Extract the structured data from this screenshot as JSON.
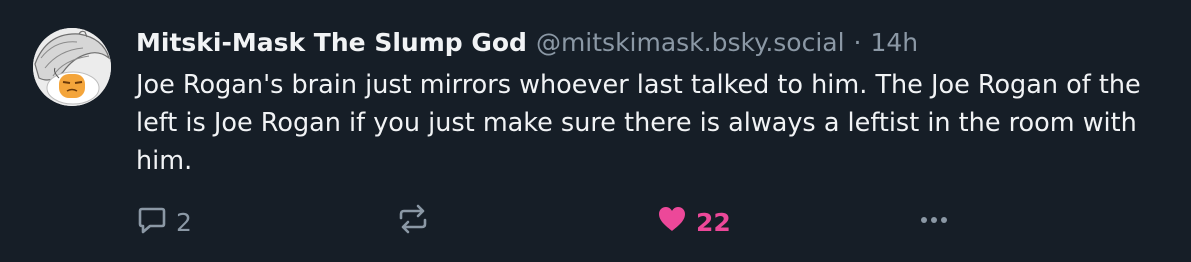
{
  "post": {
    "author": {
      "display_name": "Mitski-Mask The Slump God",
      "handle": "@mitskimask.bsky.social"
    },
    "separator": "·",
    "timestamp": "14h",
    "text": "Joe Rogan's brain just mirrors whoever last talked to him. The Joe Rogan of the left is Joe Rogan if you just make sure there is always a leftist in the room with him.",
    "actions": {
      "reply_count": "2",
      "like_count": "22"
    }
  },
  "colors": {
    "background": "#161e27",
    "text": "#f1f3f5",
    "muted": "#8b98a5",
    "like": "#ec4899"
  },
  "icons": [
    "reply-icon",
    "repost-icon",
    "heart-icon",
    "more-icon"
  ]
}
